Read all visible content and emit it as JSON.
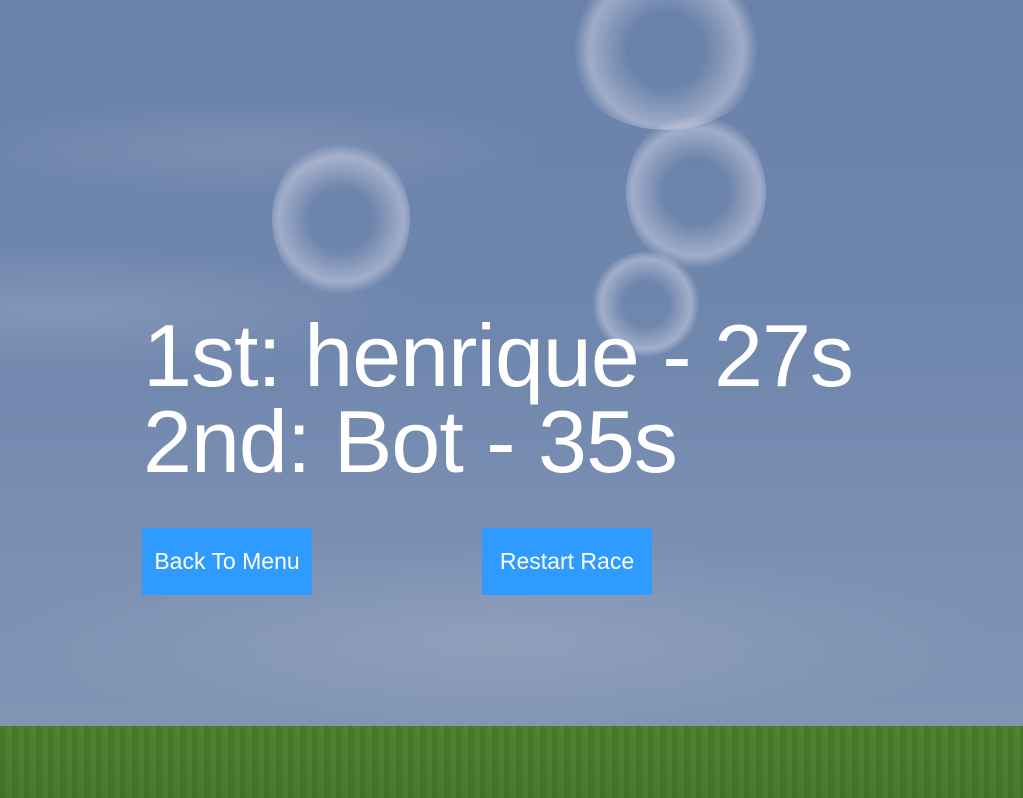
{
  "results": {
    "first": "1st: henrique - 27s",
    "second": "2nd: Bot - 35s"
  },
  "buttons": {
    "back_to_menu": "Back To Menu",
    "restart_race": "Restart Race"
  },
  "colors": {
    "sky": "#6f86ad",
    "ground": "#4a7e2c",
    "button": "#2f9bff",
    "text": "#ffffff"
  }
}
